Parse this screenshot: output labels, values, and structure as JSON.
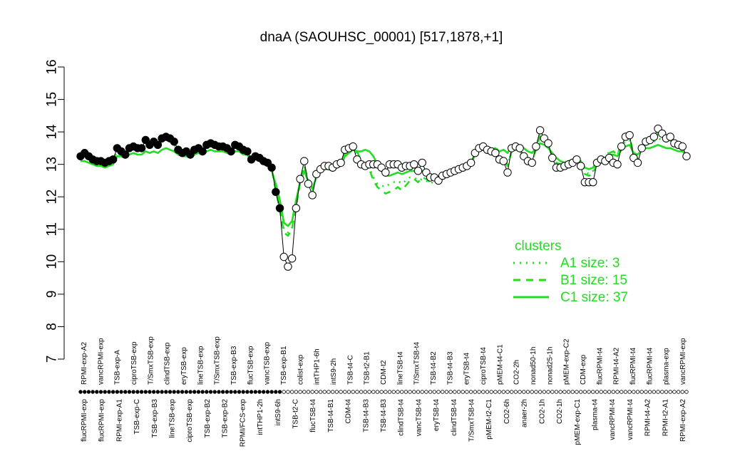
{
  "chart_data": {
    "type": "line",
    "title": "dnaA (SAOUHSC_00001) [517,1878,+1]",
    "ylim": [
      7,
      16
    ],
    "yticks": [
      7,
      8,
      9,
      10,
      11,
      12,
      13,
      14,
      15,
      16
    ],
    "x_tick_labels_top": [
      "RPMI-exp-A2",
      "vancRPMI-exp",
      "TSB-exp-A",
      "ciproTSB-exp",
      "T/SmxTSB-exp",
      "clindTSB-exp",
      "eryTSB-exp",
      "lineTSB-exp",
      "T/SmxTSB-exp",
      "TSB-exp-B3",
      "flucTSB-exp",
      "vancTSB-exp",
      "TSB-exp-B1",
      "colist-exp",
      "intTHP1-6h",
      "intS9-2h",
      "TSB-t4-C",
      "TSB-t2-B1",
      "CDM-t2",
      "lineTSB-t4",
      "T/SmxTSB-t4",
      "TSB-t4-B2",
      "TSB-t4-B3",
      "eryTSB-t4",
      "ciproTSB-t4",
      "pMEM-t4-C1",
      "CO2-2h",
      "nonad50-1h",
      "nonad25-1h",
      "pMEM-exp-C2",
      "CDM-exp",
      "flucRPMI-t4",
      "RPMI-t4-A2",
      "flucRPMI-t4",
      "flucRPMI-t4",
      "plasma-exp",
      "vancRPMI-exp"
    ],
    "x_tick_labels_bottom": [
      "flucRPMI-exp",
      "flucRPMI-exp",
      "RPMI-exp-A1",
      "TSB-exp-C",
      "TSB-exp-B3",
      "lineTSB-exp",
      "ciproTSB-exp",
      "TSB-exp-B2",
      "TSB-exp-B2",
      "RPMI/FCS-exp",
      "intTHP1-2h",
      "intS9-6h",
      "TSB-t2-C",
      "flucTSB-t4",
      "TSB-t4-B1",
      "CDM-t4",
      "TSB-t4-B3",
      "TSB-t4-B3",
      "clindTSB-t4",
      "vancTSB-t4",
      "eryTSB-t4",
      "clindTSB-t4",
      "T/SmxTSB-t4",
      "pMEM-t2-C1",
      "CO2-6h",
      "anaer-2h",
      "CO2-1h",
      "CO2-1h",
      "pMEM-exp-C1",
      "plasma-t4",
      "vancRPMI-t4",
      "vancRPMI-t4",
      "RPMI-t4-A2",
      "RPMI-t2-A1",
      "RPMI-exp-A2"
    ],
    "samples": {
      "cluster": [
        "C",
        "C",
        "C",
        "C",
        "C",
        "C",
        "C",
        "C",
        "C",
        "C",
        "C",
        "C",
        "C",
        "C",
        "C",
        "C",
        "C",
        "C",
        "C",
        "C",
        "C",
        "C",
        "C",
        "C",
        "C",
        "C",
        "C",
        "C",
        "C",
        "C",
        "C",
        "C",
        "C",
        "C",
        "C",
        "C",
        "C",
        "C",
        "C",
        "C",
        "C",
        "C",
        "C",
        "C",
        "C",
        "C",
        "C",
        "C",
        "C",
        "C",
        "B",
        "B",
        "B",
        "B",
        "B",
        "B",
        "B",
        "B",
        "B",
        "B",
        "B",
        "B",
        "B",
        "B",
        "B",
        "B",
        "B",
        "B",
        "B",
        "B",
        "B",
        "B",
        "B",
        "B",
        "B",
        "B",
        "B",
        "B",
        "B",
        "B",
        "B",
        "B",
        "B",
        "B",
        "B",
        "B",
        "B",
        "B",
        "B",
        "B",
        "B",
        "B",
        "B",
        "B",
        "B",
        "B",
        "B",
        "B",
        "B",
        "B",
        "B",
        "B",
        "B",
        "B",
        "A",
        "A",
        "A",
        "A",
        "A",
        "A",
        "A",
        "A",
        "A",
        "A",
        "A",
        "A",
        "A",
        "A",
        "A",
        "A",
        "A",
        "A",
        "A",
        "A",
        "A",
        "A",
        "A",
        "A",
        "A",
        "A",
        "A",
        "A",
        "A",
        "A",
        "A",
        "A",
        "A",
        "A",
        "A",
        "A",
        "A",
        "A",
        "A",
        "A",
        "A",
        "A",
        "A",
        "A",
        "A",
        "A",
        "A",
        "A",
        "A",
        "A",
        "A",
        "A",
        "A",
        "A"
      ],
      "values": [
        13.25,
        13.35,
        13.25,
        13.15,
        13.1,
        13.1,
        13.05,
        13.1,
        13.15,
        13.5,
        13.4,
        13.3,
        13.5,
        13.55,
        13.5,
        13.5,
        13.75,
        13.6,
        13.7,
        13.6,
        13.8,
        13.85,
        13.8,
        13.7,
        13.45,
        13.35,
        13.4,
        13.3,
        13.45,
        13.5,
        13.4,
        13.6,
        13.65,
        13.6,
        13.55,
        13.55,
        13.5,
        13.4,
        13.6,
        13.55,
        13.45,
        13.4,
        13.15,
        13.25,
        13.2,
        13.1,
        13.05,
        12.9,
        12.15,
        11.65,
        10.15,
        9.85,
        10.1,
        11.65,
        12.55,
        13.1,
        12.4,
        12.05,
        12.7,
        12.85,
        12.95,
        12.95,
        12.9,
        13.0,
        13.05,
        13.45,
        13.5,
        13.55,
        13.15,
        13.0,
        12.95,
        13.0,
        13.0,
        13.0,
        12.9,
        12.75,
        13.0,
        13.0,
        13.0,
        12.9,
        12.95,
        12.95,
        13.0,
        12.8,
        13.05,
        12.75,
        12.6,
        12.6,
        12.5,
        12.65,
        12.7,
        12.75,
        12.8,
        12.85,
        12.9,
        12.95,
        13.05,
        13.35,
        13.5,
        13.55,
        13.45,
        13.4,
        13.35,
        13.15,
        13.1,
        12.75,
        13.5,
        13.55,
        13.5,
        13.25,
        13.1,
        13.05,
        13.55,
        14.05,
        13.8,
        13.65,
        13.2,
        12.9,
        12.9,
        12.95,
        13.0,
        13.05,
        13.15,
        12.95,
        12.45,
        12.45,
        12.45,
        13.05,
        13.15,
        13.1,
        13.2,
        13.05,
        13.0,
        13.55,
        13.85,
        13.9,
        13.2,
        13.05,
        13.5,
        13.7,
        13.75,
        13.85,
        14.1,
        13.95,
        13.8,
        13.85,
        13.65,
        13.6,
        13.55,
        13.25
      ]
    },
    "cluster_lines": {
      "A1": [
        13.2,
        13.25,
        13.2,
        13.1,
        13.05,
        13.05,
        13.05,
        13.05,
        13.1,
        13.4,
        13.4,
        13.3,
        13.45,
        13.5,
        13.45,
        13.45,
        13.6,
        13.55,
        13.6,
        13.6,
        13.7,
        13.75,
        13.7,
        13.6,
        13.45,
        13.35,
        13.35,
        13.3,
        13.4,
        13.45,
        13.35,
        13.5,
        13.55,
        13.5,
        13.5,
        13.5,
        13.45,
        13.4,
        13.5,
        13.5,
        13.4,
        13.35,
        13.2,
        13.2,
        13.15,
        13.1,
        13.05,
        12.9,
        12.3,
        11.8,
        11.0,
        10.9,
        11.05,
        11.8,
        12.5,
        12.95,
        12.5,
        12.2,
        12.7,
        12.8,
        12.9,
        12.9,
        12.85,
        12.95,
        13.0,
        13.3,
        13.4,
        13.5,
        13.3,
        13.05,
        12.95,
        12.9,
        12.6,
        12.4,
        12.35,
        12.3,
        12.4,
        12.45,
        12.5,
        12.4,
        12.5,
        12.6,
        12.6,
        12.5,
        12.55,
        12.5,
        12.4,
        12.5,
        12.45,
        12.55,
        12.6,
        12.65,
        12.7,
        12.8,
        12.85,
        12.9,
        13.0,
        13.3,
        13.4,
        13.5,
        13.4,
        13.35,
        13.35,
        13.2,
        13.2,
        13.0,
        13.4,
        13.45,
        13.4,
        13.3,
        13.2,
        13.1,
        13.4,
        13.8,
        13.7,
        13.55,
        13.3,
        13.1,
        13.0,
        13.0,
        13.1,
        13.15,
        13.2,
        13.1,
        12.8,
        12.7,
        12.8,
        13.1,
        13.2,
        13.2,
        13.4,
        13.4,
        13.3,
        13.6,
        13.7,
        13.75,
        13.3,
        13.2,
        13.5,
        13.6,
        13.65,
        13.7,
        13.8,
        13.75,
        13.7,
        13.7,
        13.55,
        13.5,
        13.45,
        13.3
      ],
      "B1": [
        13.2,
        13.3,
        13.2,
        13.1,
        13.0,
        13.0,
        13.0,
        13.05,
        13.1,
        13.45,
        13.4,
        13.3,
        13.45,
        13.5,
        13.45,
        13.45,
        13.65,
        13.6,
        13.65,
        13.6,
        13.75,
        13.8,
        13.75,
        13.6,
        13.45,
        13.35,
        13.35,
        13.3,
        13.4,
        13.45,
        13.35,
        13.55,
        13.6,
        13.55,
        13.5,
        13.5,
        13.45,
        13.4,
        13.55,
        13.5,
        13.4,
        13.35,
        13.15,
        13.2,
        13.15,
        13.05,
        13.0,
        12.85,
        12.2,
        11.6,
        10.9,
        10.8,
        11.0,
        11.7,
        12.45,
        12.95,
        12.45,
        12.15,
        12.65,
        12.8,
        12.9,
        12.9,
        12.85,
        12.95,
        13.0,
        13.35,
        13.5,
        13.6,
        13.4,
        13.1,
        12.95,
        12.85,
        12.5,
        12.3,
        12.2,
        12.1,
        12.15,
        12.2,
        12.3,
        12.2,
        12.35,
        12.5,
        12.55,
        12.45,
        12.6,
        12.55,
        12.45,
        12.55,
        12.5,
        12.6,
        12.65,
        12.7,
        12.75,
        12.8,
        12.85,
        12.9,
        13.0,
        13.3,
        13.4,
        13.5,
        13.4,
        13.35,
        13.3,
        13.15,
        13.15,
        12.95,
        13.4,
        13.45,
        13.4,
        13.3,
        13.2,
        13.1,
        13.45,
        13.9,
        13.7,
        13.55,
        13.25,
        13.05,
        13.0,
        13.0,
        13.05,
        13.1,
        13.15,
        13.0,
        12.7,
        12.65,
        12.7,
        13.05,
        13.15,
        13.15,
        13.35,
        13.4,
        13.3,
        13.65,
        13.8,
        13.85,
        13.3,
        13.15,
        13.5,
        13.65,
        13.7,
        13.8,
        13.95,
        13.85,
        13.75,
        13.75,
        13.6,
        13.55,
        13.5,
        13.3
      ],
      "C1": [
        13.1,
        13.1,
        13.05,
        13.0,
        12.95,
        12.95,
        12.9,
        12.95,
        13.0,
        13.25,
        13.25,
        13.2,
        13.3,
        13.35,
        13.3,
        13.3,
        13.4,
        13.35,
        13.4,
        13.35,
        13.45,
        13.5,
        13.45,
        13.4,
        13.3,
        13.25,
        13.25,
        13.2,
        13.3,
        13.35,
        13.3,
        13.4,
        13.45,
        13.4,
        13.4,
        13.4,
        13.35,
        13.3,
        13.4,
        13.4,
        13.3,
        13.3,
        13.1,
        13.15,
        13.1,
        13.0,
        12.95,
        12.8,
        12.4,
        11.9,
        11.2,
        11.1,
        11.25,
        11.9,
        12.45,
        12.8,
        12.45,
        12.25,
        12.6,
        12.75,
        12.85,
        12.85,
        12.8,
        12.9,
        12.95,
        13.25,
        13.35,
        13.45,
        13.4,
        13.4,
        13.45,
        13.4,
        13.25,
        13.0,
        12.8,
        12.65,
        12.65,
        12.7,
        12.75,
        12.7,
        12.75,
        12.8,
        12.8,
        12.75,
        12.8,
        12.7,
        12.6,
        12.65,
        12.6,
        12.7,
        12.75,
        12.8,
        12.85,
        12.9,
        12.95,
        13.0,
        13.05,
        13.3,
        13.4,
        13.45,
        13.45,
        13.45,
        13.5,
        13.4,
        13.45,
        13.35,
        13.55,
        13.6,
        13.55,
        13.5,
        13.4,
        13.35,
        13.5,
        13.65,
        13.6,
        13.5,
        13.35,
        13.2,
        13.1,
        13.05,
        13.1,
        13.15,
        13.2,
        13.1,
        12.9,
        12.85,
        12.9,
        13.1,
        13.2,
        13.2,
        13.3,
        13.3,
        13.25,
        13.45,
        13.55,
        13.6,
        13.35,
        13.3,
        13.45,
        13.5,
        13.5,
        13.55,
        13.6,
        13.55,
        13.5,
        13.5,
        13.45,
        13.4,
        13.4,
        13.3
      ]
    },
    "legend": {
      "title": "clusters",
      "position": "right",
      "entries": [
        {
          "key": "A1",
          "label": "A1 size: 3",
          "style": "dotted"
        },
        {
          "key": "B1",
          "label": "B1 size: 15",
          "style": "dashed"
        },
        {
          "key": "C1",
          "label": "C1 size: 37",
          "style": "solid"
        }
      ]
    },
    "colors": {
      "cluster_line": "#22dd22",
      "points_filled": "#000000",
      "points_open": "#ffffff",
      "axis": "#000000"
    },
    "grid": false
  }
}
